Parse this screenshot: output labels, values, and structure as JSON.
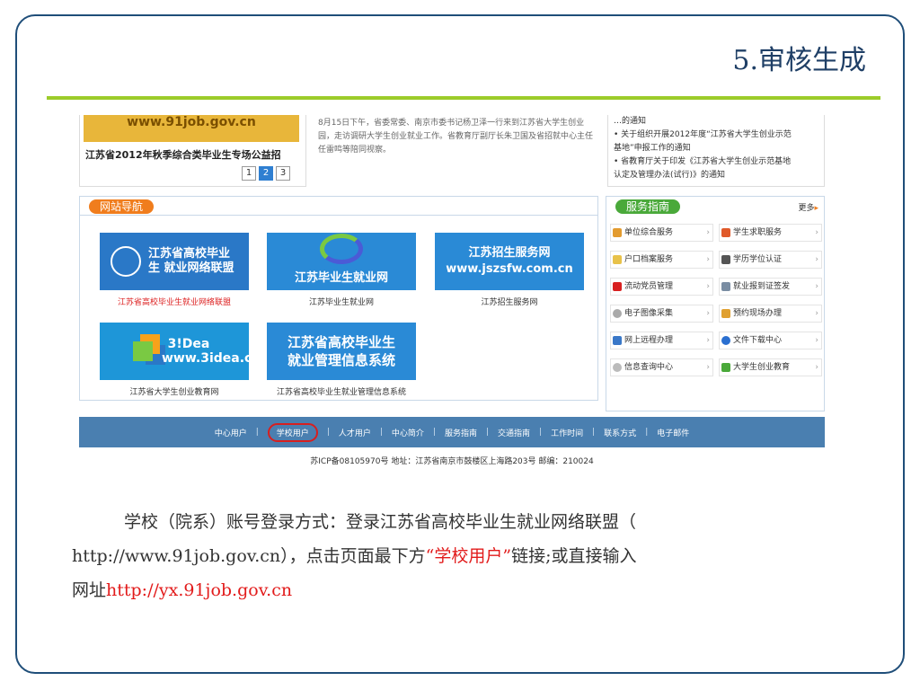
{
  "slide": {
    "title": "5.审核生成"
  },
  "screenshot": {
    "banner_text": "www.91job.gov.cn",
    "banner_caption": "江苏省2012年秋季综合类毕业生专场公益招",
    "pager": [
      "1",
      "2",
      "3"
    ],
    "news_mid": "8月15日下午，省委常委、南京市委书记杨卫泽一行来到江苏省大学生创业园，走访调研大学生创业就业工作。省教育厅副厅长朱卫国及省招就中心主任任雷鸣等陪同视察。",
    "news_right": [
      "…的通知",
      "• 关于组织开展2012年度“江苏省大学生创业示范",
      "基地”申报工作的通知",
      "• 省教育厅关于印发《江苏省大学生创业示范基地",
      "认定及管理办法(试行)》的通知"
    ],
    "nav_title": "网站导航",
    "sites": [
      {
        "logo": "江苏省高校毕业生 就业网络联盟",
        "caption": "江苏省高校毕业生就业网络联盟"
      },
      {
        "logo": "江苏毕业生就业网",
        "caption": "江苏毕业生就业网"
      },
      {
        "logo": "江苏招生服务网 www.jszsfw.com.cn",
        "caption": "江苏招生服务网"
      },
      {
        "logo": "3!Dea www.3idea.cn",
        "caption": "江苏省大学生创业教育网"
      },
      {
        "logo": "江苏省高校毕业生 就业管理信息系统",
        "caption": "江苏省高校毕业生就业管理信息系统"
      }
    ],
    "service_title": "服务指南",
    "more": "更多",
    "services": [
      "单位综合服务",
      "学生求职服务",
      "户口档案服务",
      "学历学位认证",
      "流动党员管理",
      "就业报到证签发",
      "电子图像采集",
      "预约现场办理",
      "网上远程办理",
      "文件下载中心",
      "信息查询中心",
      "大学生创业教育"
    ],
    "footer_links": [
      "中心用户",
      "学校用户",
      "人才用户",
      "中心简介",
      "服务指南",
      "交通指南",
      "工作时间",
      "联系方式",
      "电子邮件"
    ],
    "footer_copy": "苏ICP备08105970号  地址：江苏省南京市鼓楼区上海路203号  邮编：210024"
  },
  "body": {
    "p1": "学校（院系）账号登录方式：登录江苏省高校毕业生就业网络联盟（",
    "p2": "http://www.91job.gov.cn），点击页面最下方",
    "p2_red": "“学校用户”",
    "p2_end": "链接;或直接输入",
    "p3": "网址",
    "p3_red": "http://yx.91job.gov.cn"
  },
  "colors": {
    "frame": "#1f4e79",
    "title_rule": "#9ccc2a",
    "footer_bar": "#4a7fb0",
    "highlight": "#e21b1b"
  }
}
